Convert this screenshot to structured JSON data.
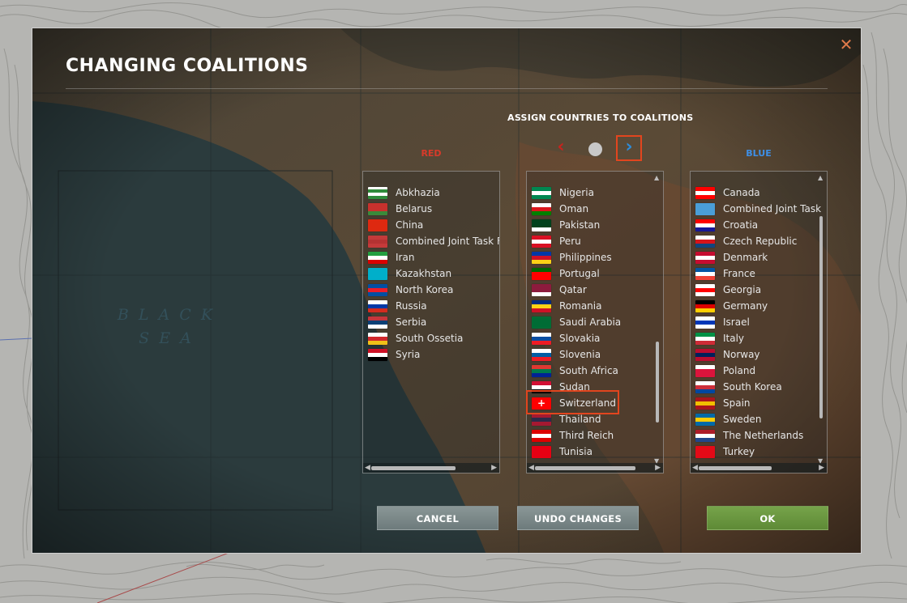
{
  "dialog": {
    "title": "CHANGING COALITIONS",
    "close_glyph": "✕",
    "assign_heading": "ASSIGN COUNTRIES TO COALITIONS"
  },
  "map": {
    "label_line1": "B L A C K",
    "label_line2": "S E A"
  },
  "pager": {
    "prev_glyph": "‹",
    "next_glyph": "›"
  },
  "columns": {
    "red_header": "RED",
    "blue_header": "BLUE"
  },
  "lists": {
    "red": [
      {
        "name": "Abkhazia",
        "flag": [
          "#ffffff",
          "#2e8b3a",
          "#ffffff",
          "#2e8b3a"
        ]
      },
      {
        "name": "Belarus",
        "flag": [
          "#c8312d",
          "#c8312d",
          "#3a8a3a"
        ]
      },
      {
        "name": "China",
        "flag": [
          "#de2910",
          "#de2910",
          "#de2910"
        ]
      },
      {
        "name": "Combined Joint Task Fo",
        "flag": [
          "#c43a3a",
          "#b53232",
          "#c43a3a"
        ]
      },
      {
        "name": "Iran",
        "flag": [
          "#239f40",
          "#ffffff",
          "#da0000"
        ]
      },
      {
        "name": "Kazakhstan",
        "flag": [
          "#00afca",
          "#00afca",
          "#00afca"
        ]
      },
      {
        "name": "North Korea",
        "flag": [
          "#024fa2",
          "#ed1c27",
          "#024fa2"
        ]
      },
      {
        "name": "Russia",
        "flag": [
          "#ffffff",
          "#0039a6",
          "#d52b1e"
        ]
      },
      {
        "name": "Serbia",
        "flag": [
          "#c6363c",
          "#0c4076",
          "#ffffff"
        ]
      },
      {
        "name": "South Ossetia",
        "flag": [
          "#ffffff",
          "#d0282c",
          "#f0c018"
        ]
      },
      {
        "name": "Syria",
        "flag": [
          "#ce1126",
          "#ffffff",
          "#000000"
        ]
      }
    ],
    "middle": [
      {
        "name": "Nigeria",
        "flag": [
          "#008751",
          "#ffffff",
          "#008751"
        ]
      },
      {
        "name": "Oman",
        "flag": [
          "#ffffff",
          "#db161b",
          "#008000"
        ]
      },
      {
        "name": "Pakistan",
        "flag": [
          "#01411c",
          "#01411c",
          "#ffffff"
        ]
      },
      {
        "name": "Peru",
        "flag": [
          "#d91023",
          "#ffffff",
          "#d91023"
        ]
      },
      {
        "name": "Philippines",
        "flag": [
          "#0038a8",
          "#ce1126",
          "#fcd116"
        ]
      },
      {
        "name": "Portugal",
        "flag": [
          "#006600",
          "#ff0000",
          "#ff0000"
        ]
      },
      {
        "name": "Qatar",
        "flag": [
          "#8d1b3d",
          "#8d1b3d",
          "#ffffff"
        ]
      },
      {
        "name": "Romania",
        "flag": [
          "#002b7f",
          "#fcd116",
          "#ce1126"
        ]
      },
      {
        "name": "Saudi Arabia",
        "flag": [
          "#006c35",
          "#006c35",
          "#006c35"
        ]
      },
      {
        "name": "Slovakia",
        "flag": [
          "#ffffff",
          "#0b4ea2",
          "#ee1c25"
        ]
      },
      {
        "name": "Slovenia",
        "flag": [
          "#ffffff",
          "#005da4",
          "#ed1c24"
        ]
      },
      {
        "name": "South Africa",
        "flag": [
          "#de3831",
          "#007a4d",
          "#002395"
        ]
      },
      {
        "name": "Sudan",
        "flag": [
          "#d21034",
          "#ffffff",
          "#000000"
        ]
      },
      {
        "name": "Switzerland",
        "flag": [
          "#ff0000",
          "#ff0000",
          "#ff0000"
        ]
      },
      {
        "name": "Thailand",
        "flag": [
          "#a51931",
          "#2d2a4a",
          "#a51931"
        ]
      },
      {
        "name": "Third Reich",
        "flag": [
          "#dd0000",
          "#ffffff",
          "#dd0000"
        ]
      },
      {
        "name": "Tunisia",
        "flag": [
          "#e70013",
          "#e70013",
          "#e70013"
        ]
      }
    ],
    "blue": [
      {
        "name": "Canada",
        "flag": [
          "#ff0000",
          "#ffffff",
          "#ff0000"
        ]
      },
      {
        "name": "Combined Joint Task",
        "flag": [
          "#4a9ed8",
          "#4a9ed8",
          "#4a9ed8"
        ]
      },
      {
        "name": "Croatia",
        "flag": [
          "#ff0000",
          "#ffffff",
          "#171796"
        ]
      },
      {
        "name": "Czech Republic",
        "flag": [
          "#ffffff",
          "#d7141a",
          "#11457e"
        ]
      },
      {
        "name": "Denmark",
        "flag": [
          "#c60c30",
          "#ffffff",
          "#c60c30"
        ]
      },
      {
        "name": "France",
        "flag": [
          "#0055a4",
          "#ffffff",
          "#ef4135"
        ]
      },
      {
        "name": "Georgia",
        "flag": [
          "#ffffff",
          "#ff0000",
          "#ffffff"
        ]
      },
      {
        "name": "Germany",
        "flag": [
          "#000000",
          "#dd0000",
          "#ffce00"
        ]
      },
      {
        "name": "Israel",
        "flag": [
          "#ffffff",
          "#0038b8",
          "#ffffff"
        ]
      },
      {
        "name": "Italy",
        "flag": [
          "#009246",
          "#ffffff",
          "#ce2b37"
        ]
      },
      {
        "name": "Norway",
        "flag": [
          "#ba0c2f",
          "#00205b",
          "#ba0c2f"
        ]
      },
      {
        "name": "Poland",
        "flag": [
          "#ffffff",
          "#dc143c",
          "#dc143c"
        ]
      },
      {
        "name": "South Korea",
        "flag": [
          "#ffffff",
          "#cd2e3a",
          "#0047a0"
        ]
      },
      {
        "name": "Spain",
        "flag": [
          "#aa151b",
          "#f1bf00",
          "#aa151b"
        ]
      },
      {
        "name": "Sweden",
        "flag": [
          "#006aa7",
          "#fecc00",
          "#006aa7"
        ]
      },
      {
        "name": "The Netherlands",
        "flag": [
          "#ae1c28",
          "#ffffff",
          "#21468b"
        ]
      },
      {
        "name": "Turkey",
        "flag": [
          "#e30a17",
          "#e30a17",
          "#e30a17"
        ]
      }
    ]
  },
  "selected_item": "Switzerland",
  "buttons": {
    "cancel": "CANCEL",
    "undo": "UNDO CHANGES",
    "ok": "OK"
  },
  "colors": {
    "red_header": "#d83a2a",
    "blue_header": "#3e8fe6",
    "highlight": "#e2451e",
    "ok_button": "#6a9a40",
    "neutral_button": "#7c8a8b"
  }
}
